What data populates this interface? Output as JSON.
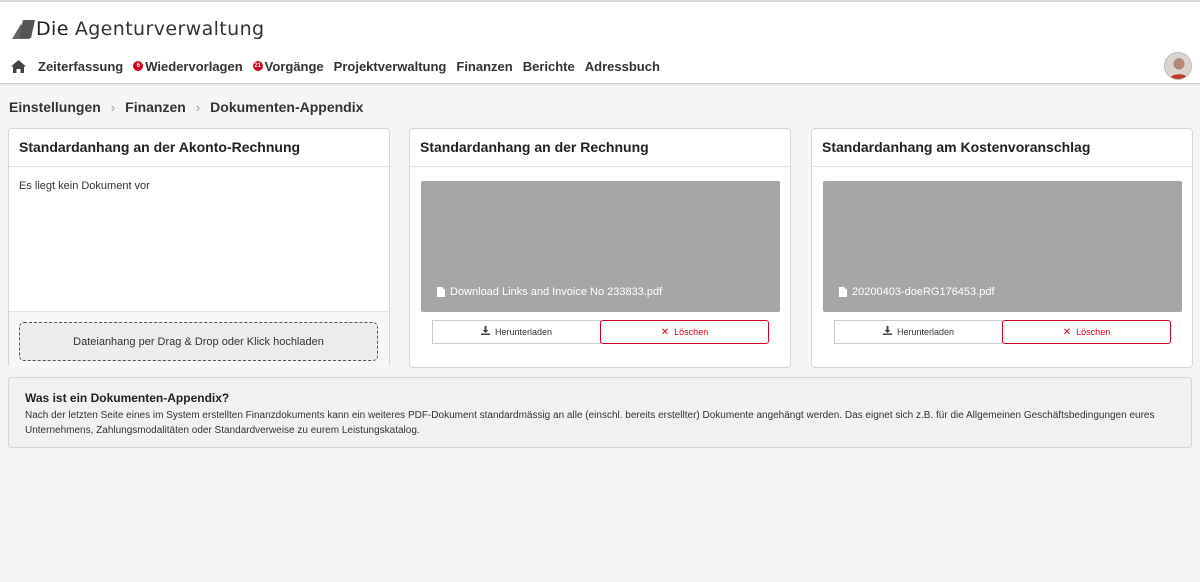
{
  "app": {
    "logo_text_1": "Die",
    "logo_text_2": "Agenturverwaltung"
  },
  "nav": {
    "items": [
      {
        "label": "Zeiterfassung"
      },
      {
        "label": "Wiedervorlagen",
        "badge": "6"
      },
      {
        "label": "Vorgänge",
        "badge": "21"
      },
      {
        "label": "Projektverwaltung"
      },
      {
        "label": "Finanzen"
      },
      {
        "label": "Berichte"
      },
      {
        "label": "Adressbuch"
      }
    ]
  },
  "breadcrumb": [
    "Einstellungen",
    "Finanzen",
    "Dokumenten-Appendix"
  ],
  "cards": [
    {
      "title": "Standardanhang an der Akonto-Rechnung",
      "empty_text": "Es liegt kein Dokument vor",
      "dropzone_label": "Dateianhang per Drag & Drop oder Klick hochladen"
    },
    {
      "title": "Standardanhang an der Rechnung",
      "file_name": "Download Links and Invoice No 233833.pdf",
      "download_label": "Herunterladen",
      "delete_label": "Löschen"
    },
    {
      "title": "Standardanhang am Kostenvoranschlag",
      "file_name": "20200403-doeRG176453.pdf",
      "download_label": "Herunterladen",
      "delete_label": "Löschen"
    }
  ],
  "info": {
    "title": "Was ist ein Dokumenten-Appendix?",
    "text": "Nach der letzten Seite eines im System erstellten Finanzdokuments kann ein weiteres PDF-Dokument standardmässig an alle (einschl. bereits erstellter) Dokumente angehängt werden. Das eignet sich z.B. für die Allgemeinen Geschäftsbedingungen eures Unternehmens, Zahlungsmodalitäten oder Standardverweise zu eurem Leistungskatalog."
  },
  "colors": {
    "accent_red": "#d0021b",
    "preview_gray": "#a6a6a6"
  },
  "icons": {
    "home": "home-icon",
    "download": "download-icon",
    "delete": "close-icon",
    "file": "file-icon",
    "logo": "logo-icon"
  }
}
